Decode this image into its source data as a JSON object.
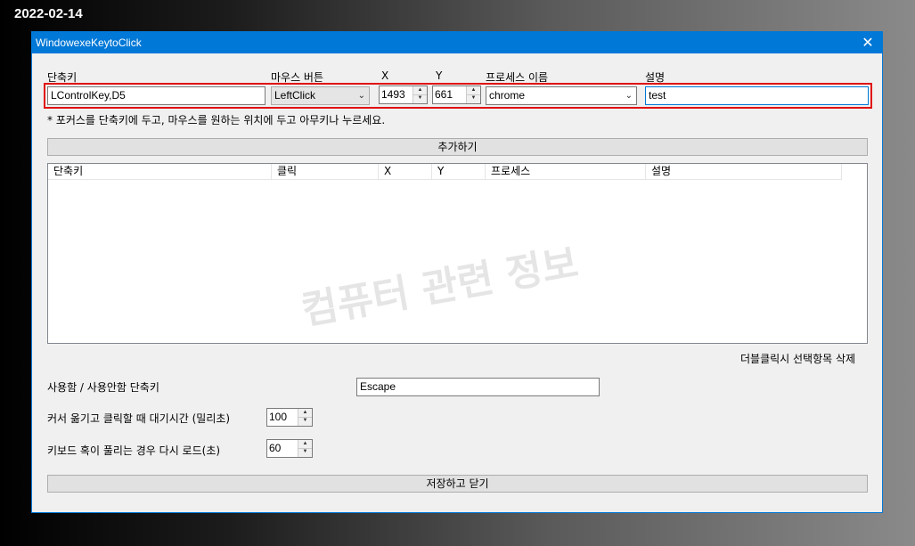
{
  "desktop": {
    "date": "2022-02-14"
  },
  "window": {
    "title": "WindowexeKeytoClick",
    "close_symbol": "✕"
  },
  "form": {
    "labels": {
      "hotkey": "단축키",
      "mouse_button": "마우스 버튼",
      "x": "X",
      "y": "Y",
      "process_name": "프로세스 이름",
      "description": "설명"
    },
    "hotkey_value": "LControlKey,D5",
    "mouse_button_value": "LeftClick",
    "x_value": "1493",
    "y_value": "661",
    "process_value": "chrome",
    "description_value": "test",
    "hint": "* 포커스를 단축키에 두고, 마우스를 원하는 위치에 두고 아무키나 누르세요.",
    "add_button": "추가하기"
  },
  "list": {
    "columns": [
      "단축키",
      "클릭",
      "X",
      "Y",
      "프로세스",
      "설명"
    ],
    "rows": [],
    "watermark": "컴퓨터 관련 정보",
    "delete_hint": "더블클릭시 선택항목 삭제"
  },
  "settings": {
    "toggle_label": "사용함 / 사용안함 단축키",
    "toggle_value": "Escape",
    "delay_label": "커서 옮기고 클릭할 때 대기시간 (밀리초)",
    "delay_value": "100",
    "reload_label": "키보드 혹이 풀리는 경우 다시 로드(초)",
    "reload_value": "60"
  },
  "footer": {
    "save_button": "저장하고 닫기"
  }
}
